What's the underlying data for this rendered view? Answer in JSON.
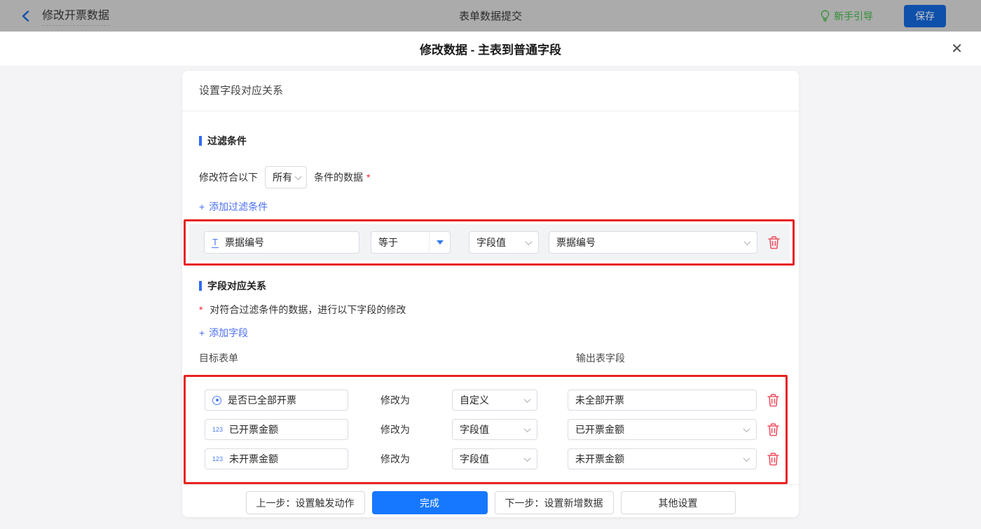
{
  "topbar": {
    "back_label": "修改开票数据",
    "center_title": "表单数据提交",
    "guide_label": "新手引导",
    "save_label": "保存"
  },
  "modal": {
    "title": "修改数据 - 主表到普通字段",
    "close_glyph": "✕"
  },
  "panel": {
    "header": "设置字段对应关系",
    "filter_section": {
      "title": "过滤条件",
      "line_prefix": "修改符合以下",
      "match_select_value": "所有",
      "line_suffix": "条件的数据",
      "required_mark": "*",
      "plus_glyph": "+",
      "add_link": "添加过滤条件",
      "condition": {
        "field": "票据编号",
        "field_icon_text": "T",
        "operator": "等于",
        "value_type": "字段值",
        "value": "票据编号"
      }
    },
    "mapping_section": {
      "title": "字段对应关系",
      "hint_mark": "*",
      "hint": "对符合过滤条件的数据，进行以下字段的修改",
      "plus_glyph": "+",
      "add_link": "添加字段",
      "col_target": "目标表单",
      "col_output": "输出表字段",
      "modify_label": "修改为",
      "rows": [
        {
          "field": "是否已全部开票",
          "icon": "radio-icon",
          "icon_text": "",
          "type": "自定义",
          "value": "未全部开票",
          "value_kind": "input"
        },
        {
          "field": "已开票金额",
          "icon": "number-icon",
          "icon_text": "123",
          "type": "字段值",
          "value": "已开票金额",
          "value_kind": "select"
        },
        {
          "field": "未开票金额",
          "icon": "number-icon",
          "icon_text": "123",
          "type": "字段值",
          "value": "未开票金额",
          "value_kind": "select"
        }
      ]
    },
    "footer": {
      "prev_label": "上一步：设置触发动作",
      "done_label": "完成",
      "next_label": "下一步：设置新增数据",
      "other_label": "其他设置"
    }
  },
  "colors": {
    "primary_blue": "#1677ff",
    "link_blue": "#4b6ff0",
    "section_bar_blue": "#2f6bf5",
    "annotation_red": "#e82222",
    "required_red": "#f5222d",
    "trash_red": "#f05363",
    "guide_green": "#2f8f33",
    "topbar_dimmed_gray": "#ababab"
  }
}
